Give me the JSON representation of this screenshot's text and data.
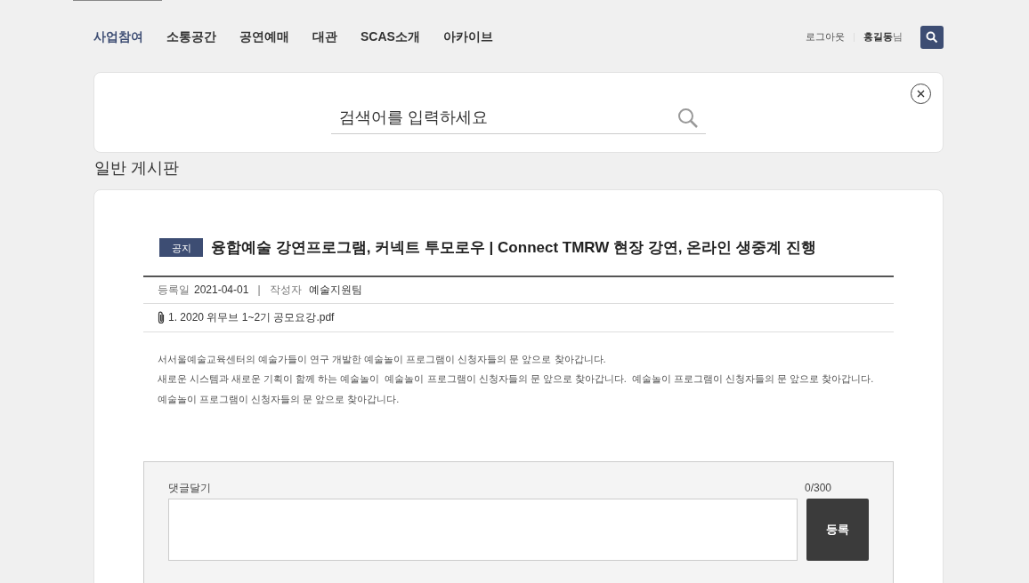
{
  "nav": {
    "items": [
      {
        "label": "사업참여",
        "selected": true
      },
      {
        "label": "소통공간",
        "selected": false
      },
      {
        "label": "공연예매",
        "selected": false
      },
      {
        "label": "대관",
        "selected": false
      },
      {
        "label": "SCAS소개",
        "selected": false
      },
      {
        "label": "아카이브",
        "selected": false
      }
    ],
    "logout": "로그아웃",
    "user": "홍길동",
    "user_suffix": "님"
  },
  "search": {
    "placeholder": "검색어를 입력하세요"
  },
  "page_title": "일반 게시판",
  "post": {
    "badge": "공지",
    "title": "융합예술 강연프로그램, 커넥트 투모로우 | Connect TMRW 현장 강연, 온라인 생중계 진행",
    "date_label": "등록일",
    "date": "2021-04-01",
    "separator": "|",
    "author_label": "작성자",
    "author": "예술지원팀",
    "attachment": "1. 2020 위무브 1~2기 공모요강.pdf",
    "body": [
      "서서울예술교육센터의 예술가들이 연구 개발한 예술놀이 프로그램이 신청자들의 문 앞으로 찾아갑니다.",
      "새로운 시스템과 새로운 기획이 함께 하는 예술놀이  예술놀이 프로그램이 신청자들의 문 앞으로 찾아갑니다.  예술놀이 프로그램이 신청자들의 문 앞으로 찾아갑니다.",
      "예술놀이 프로그램이 신청자들의 문 앞으로 찾아갑니다."
    ]
  },
  "comment": {
    "label": "댓글달기",
    "count": "0/300",
    "submit": "등록"
  }
}
